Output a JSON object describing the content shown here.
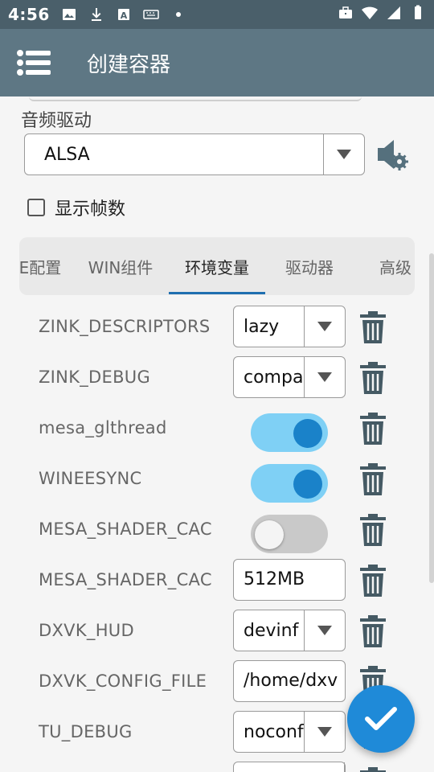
{
  "status_bar": {
    "time": "4:56",
    "left_icons": [
      "image-icon",
      "download-icon",
      "a-icon",
      "keyboard-icon",
      "dot-icon"
    ],
    "right_icons": [
      "briefcase-icon",
      "wifi-icon",
      "signal-icon",
      "battery-icon"
    ]
  },
  "appbar": {
    "title": "创建容器",
    "menu_icon": "menu-list-icon"
  },
  "audio": {
    "label": "音频驱动",
    "value": "ALSA"
  },
  "show_fps": {
    "label": "显示帧数",
    "checked": false
  },
  "tabs": [
    {
      "label": "E配置"
    },
    {
      "label": "WIN组件"
    },
    {
      "label": "环境变量",
      "active": true
    },
    {
      "label": "驱动器"
    },
    {
      "label": "高级"
    }
  ],
  "env_vars": [
    {
      "name": "ZINK_DESCRIPTORS",
      "value": "lazy"
    },
    {
      "name": "ZINK_DEBUG",
      "value": "compa"
    },
    {
      "name": "mesa_glthread",
      "value": "on"
    },
    {
      "name": "WINEESYNC",
      "value": "on"
    },
    {
      "name": "MESA_SHADER_CAC",
      "value": "off"
    },
    {
      "name": "MESA_SHADER_CAC",
      "value": "512MB"
    },
    {
      "name": "DXVK_HUD",
      "value": "devinf"
    },
    {
      "name": "DXVK_CONFIG_FILE",
      "value": "/home/dxv"
    },
    {
      "name": "TU_DEBUG",
      "value": "noconf"
    }
  ],
  "colors": {
    "appbar": "#5e7784",
    "status_bar": "#4a5f6a",
    "accent": "#1f8ad8",
    "toggle_on": "#7fd0f5"
  }
}
